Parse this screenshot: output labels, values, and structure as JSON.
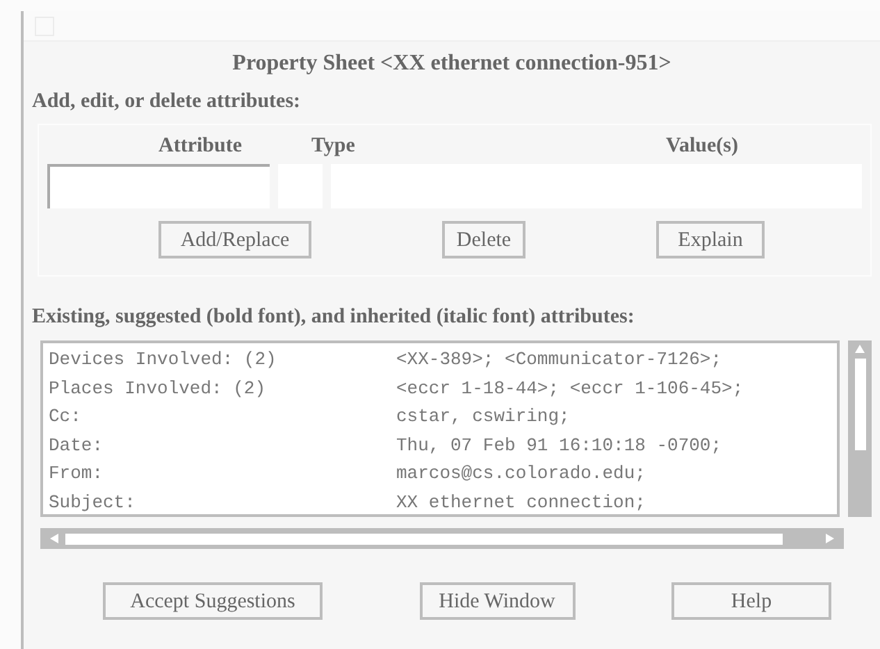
{
  "heading": "Property Sheet <XX ethernet connection-951>",
  "edit_section": {
    "label": "Add, edit, or delete attributes:",
    "columns": [
      "Attribute",
      "Type",
      "Value(s)"
    ],
    "buttons": [
      "Add/Replace",
      "Delete",
      "Explain"
    ]
  },
  "existing_section": {
    "label": "Existing, suggested (bold font), and inherited (italic font) attributes:",
    "rows": [
      {
        "name": "Devices Involved: (2)",
        "value": "<XX-389>; <Communicator-7126>;"
      },
      {
        "name": "Places Involved: (2)",
        "value": "<eccr 1-18-44>; <eccr 1-106-45>;"
      },
      {
        "name": "Cc:",
        "value": "cstar, cswiring;"
      },
      {
        "name": "Date:",
        "value": "Thu, 07 Feb 91 16:10:18 -0700;"
      },
      {
        "name": "From:",
        "value": "marcos@cs.colorado.edu;"
      },
      {
        "name": "Subject:",
        "value": "XX ethernet connection;"
      }
    ]
  },
  "buttons": [
    "Accept Suggestions",
    "Hide Window",
    "Help"
  ]
}
